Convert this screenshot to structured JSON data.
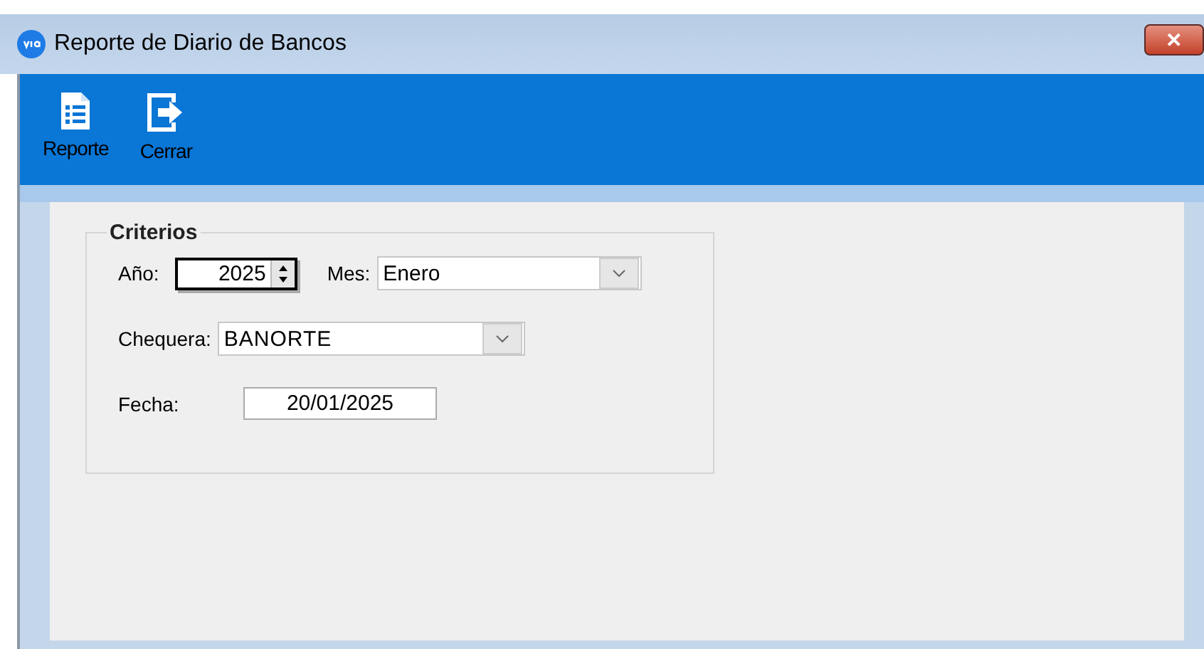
{
  "window": {
    "title": "Reporte de Diario de Bancos",
    "close": "✕"
  },
  "toolbar": [
    {
      "kind": "report",
      "label": "Reporte"
    },
    {
      "kind": "exit",
      "label": "Cerrar"
    }
  ],
  "criteria": {
    "title": "Criterios",
    "year_label": "Año:",
    "year": "2025",
    "month_label": "Mes:",
    "month": "Enero",
    "checkbook_label": "Chequera:",
    "checkbook": "BANORTE",
    "date_label": "Fecha:",
    "date": "20/01/2025"
  }
}
